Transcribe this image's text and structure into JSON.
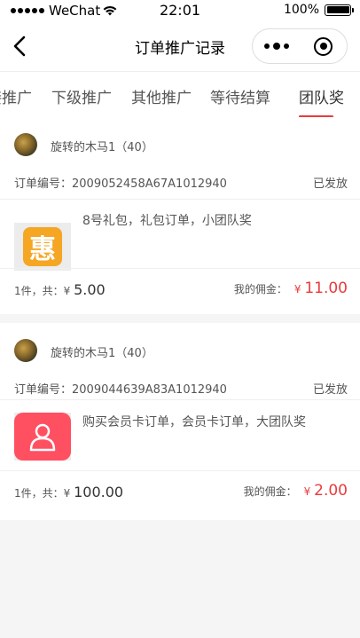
{
  "status_bar": {
    "carrier": "WeChat",
    "time": "22:01",
    "battery": "100%"
  },
  "nav": {
    "title": "订单推广记录"
  },
  "tabs": [
    {
      "label": "接推广"
    },
    {
      "label": "下级推广"
    },
    {
      "label": "其他推广"
    },
    {
      "label": "等待结算"
    },
    {
      "label": "团队奖",
      "active": true
    }
  ],
  "orders": [
    {
      "user": "旋转的木马1（40）",
      "order_label": "订单编号：",
      "order_no": "2009052458A67A1012940",
      "status": "已发放",
      "product_icon": "hui-icon",
      "product_icon_text": "惠",
      "product_title": "8号礼包，礼包订单，小团队奖",
      "qty_text": "1件，共：",
      "total_currency": "¥",
      "total": "5.00",
      "commission_label": "我的佣金：",
      "commission_currency": "¥",
      "commission": "11.00"
    },
    {
      "user": "旋转的木马1（40）",
      "order_label": "订单编号：",
      "order_no": "2009044639A83A1012940",
      "status": "已发放",
      "product_icon": "member-user-icon",
      "product_title": "购买会员卡订单，会员卡订单，大团队奖",
      "qty_text": "1件，共：",
      "total_currency": "¥",
      "total": "100.00",
      "commission_label": "我的佣金：",
      "commission_currency": "¥",
      "commission": "2.00"
    }
  ],
  "colors": {
    "accent": "#e93b3d",
    "background": "#f5f5f5"
  }
}
